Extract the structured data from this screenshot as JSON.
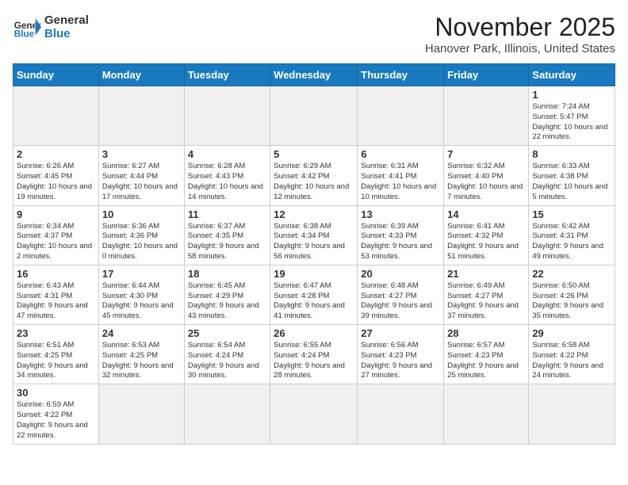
{
  "header": {
    "logo_text_general": "General",
    "logo_text_blue": "Blue",
    "title": "November 2025",
    "subtitle": "Hanover Park, Illinois, United States"
  },
  "days_of_week": [
    "Sunday",
    "Monday",
    "Tuesday",
    "Wednesday",
    "Thursday",
    "Friday",
    "Saturday"
  ],
  "weeks": [
    [
      {
        "day": "",
        "info": ""
      },
      {
        "day": "",
        "info": ""
      },
      {
        "day": "",
        "info": ""
      },
      {
        "day": "",
        "info": ""
      },
      {
        "day": "",
        "info": ""
      },
      {
        "day": "",
        "info": ""
      },
      {
        "day": "1",
        "info": "Sunrise: 7:24 AM\nSunset: 5:47 PM\nDaylight: 10 hours and 22 minutes."
      }
    ],
    [
      {
        "day": "2",
        "info": "Sunrise: 6:26 AM\nSunset: 4:45 PM\nDaylight: 10 hours and 19 minutes."
      },
      {
        "day": "3",
        "info": "Sunrise: 6:27 AM\nSunset: 4:44 PM\nDaylight: 10 hours and 17 minutes."
      },
      {
        "day": "4",
        "info": "Sunrise: 6:28 AM\nSunset: 4:43 PM\nDaylight: 10 hours and 14 minutes."
      },
      {
        "day": "5",
        "info": "Sunrise: 6:29 AM\nSunset: 4:42 PM\nDaylight: 10 hours and 12 minutes."
      },
      {
        "day": "6",
        "info": "Sunrise: 6:31 AM\nSunset: 4:41 PM\nDaylight: 10 hours and 10 minutes."
      },
      {
        "day": "7",
        "info": "Sunrise: 6:32 AM\nSunset: 4:40 PM\nDaylight: 10 hours and 7 minutes."
      },
      {
        "day": "8",
        "info": "Sunrise: 6:33 AM\nSunset: 4:38 PM\nDaylight: 10 hours and 5 minutes."
      }
    ],
    [
      {
        "day": "9",
        "info": "Sunrise: 6:34 AM\nSunset: 4:37 PM\nDaylight: 10 hours and 2 minutes."
      },
      {
        "day": "10",
        "info": "Sunrise: 6:36 AM\nSunset: 4:36 PM\nDaylight: 10 hours and 0 minutes."
      },
      {
        "day": "11",
        "info": "Sunrise: 6:37 AM\nSunset: 4:35 PM\nDaylight: 9 hours and 58 minutes."
      },
      {
        "day": "12",
        "info": "Sunrise: 6:38 AM\nSunset: 4:34 PM\nDaylight: 9 hours and 56 minutes."
      },
      {
        "day": "13",
        "info": "Sunrise: 6:39 AM\nSunset: 4:33 PM\nDaylight: 9 hours and 53 minutes."
      },
      {
        "day": "14",
        "info": "Sunrise: 6:41 AM\nSunset: 4:32 PM\nDaylight: 9 hours and 51 minutes."
      },
      {
        "day": "15",
        "info": "Sunrise: 6:42 AM\nSunset: 4:31 PM\nDaylight: 9 hours and 49 minutes."
      }
    ],
    [
      {
        "day": "16",
        "info": "Sunrise: 6:43 AM\nSunset: 4:31 PM\nDaylight: 9 hours and 47 minutes."
      },
      {
        "day": "17",
        "info": "Sunrise: 6:44 AM\nSunset: 4:30 PM\nDaylight: 9 hours and 45 minutes."
      },
      {
        "day": "18",
        "info": "Sunrise: 6:45 AM\nSunset: 4:29 PM\nDaylight: 9 hours and 43 minutes."
      },
      {
        "day": "19",
        "info": "Sunrise: 6:47 AM\nSunset: 4:28 PM\nDaylight: 9 hours and 41 minutes."
      },
      {
        "day": "20",
        "info": "Sunrise: 6:48 AM\nSunset: 4:27 PM\nDaylight: 9 hours and 39 minutes."
      },
      {
        "day": "21",
        "info": "Sunrise: 6:49 AM\nSunset: 4:27 PM\nDaylight: 9 hours and 37 minutes."
      },
      {
        "day": "22",
        "info": "Sunrise: 6:50 AM\nSunset: 4:26 PM\nDaylight: 9 hours and 35 minutes."
      }
    ],
    [
      {
        "day": "23",
        "info": "Sunrise: 6:51 AM\nSunset: 4:25 PM\nDaylight: 9 hours and 34 minutes."
      },
      {
        "day": "24",
        "info": "Sunrise: 6:53 AM\nSunset: 4:25 PM\nDaylight: 9 hours and 32 minutes."
      },
      {
        "day": "25",
        "info": "Sunrise: 6:54 AM\nSunset: 4:24 PM\nDaylight: 9 hours and 30 minutes."
      },
      {
        "day": "26",
        "info": "Sunrise: 6:55 AM\nSunset: 4:24 PM\nDaylight: 9 hours and 28 minutes."
      },
      {
        "day": "27",
        "info": "Sunrise: 6:56 AM\nSunset: 4:23 PM\nDaylight: 9 hours and 27 minutes."
      },
      {
        "day": "28",
        "info": "Sunrise: 6:57 AM\nSunset: 4:23 PM\nDaylight: 9 hours and 25 minutes."
      },
      {
        "day": "29",
        "info": "Sunrise: 6:58 AM\nSunset: 4:22 PM\nDaylight: 9 hours and 24 minutes."
      }
    ],
    [
      {
        "day": "30",
        "info": "Sunrise: 6:59 AM\nSunset: 4:22 PM\nDaylight: 9 hours and 22 minutes."
      },
      {
        "day": "",
        "info": ""
      },
      {
        "day": "",
        "info": ""
      },
      {
        "day": "",
        "info": ""
      },
      {
        "day": "",
        "info": ""
      },
      {
        "day": "",
        "info": ""
      },
      {
        "day": "",
        "info": ""
      }
    ]
  ]
}
